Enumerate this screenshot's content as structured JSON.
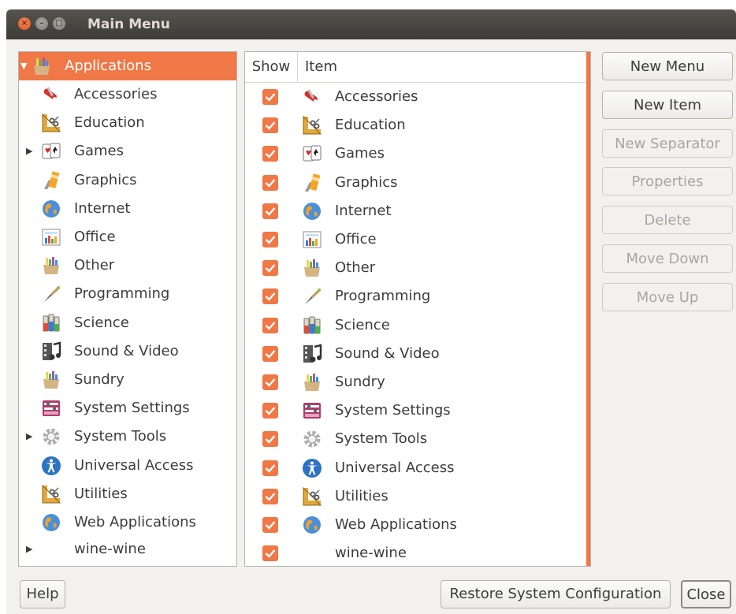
{
  "window": {
    "title": "Main Menu"
  },
  "tree": {
    "selected": {
      "label": "Applications",
      "icon": "applications-other-icon"
    },
    "items": [
      {
        "label": "Accessories",
        "icon": "accessories-icon",
        "expander": false
      },
      {
        "label": "Education",
        "icon": "education-icon",
        "expander": false
      },
      {
        "label": "Games",
        "icon": "games-icon",
        "expander": true
      },
      {
        "label": "Graphics",
        "icon": "graphics-icon",
        "expander": false
      },
      {
        "label": "Internet",
        "icon": "internet-icon",
        "expander": false
      },
      {
        "label": "Office",
        "icon": "office-icon",
        "expander": false
      },
      {
        "label": "Other",
        "icon": "other-icon",
        "expander": false
      },
      {
        "label": "Programming",
        "icon": "programming-icon",
        "expander": false
      },
      {
        "label": "Science",
        "icon": "science-icon",
        "expander": false
      },
      {
        "label": "Sound & Video",
        "icon": "sound-video-icon",
        "expander": false
      },
      {
        "label": "Sundry",
        "icon": "sundry-icon",
        "expander": false
      },
      {
        "label": "System Settings",
        "icon": "system-settings-icon",
        "expander": false
      },
      {
        "label": "System Tools",
        "icon": "system-tools-icon",
        "expander": true
      },
      {
        "label": "Universal Access",
        "icon": "universal-access-icon",
        "expander": false
      },
      {
        "label": "Utilities",
        "icon": "utilities-icon",
        "expander": false
      },
      {
        "label": "Web Applications",
        "icon": "web-applications-icon",
        "expander": false
      },
      {
        "label": "wine-wine",
        "icon": "",
        "expander": true
      }
    ]
  },
  "list": {
    "header_show": "Show",
    "header_item": "Item",
    "rows": [
      {
        "label": "Accessories",
        "shown": true
      },
      {
        "label": "Education",
        "shown": true
      },
      {
        "label": "Games",
        "shown": true
      },
      {
        "label": "Graphics",
        "shown": true
      },
      {
        "label": "Internet",
        "shown": true
      },
      {
        "label": "Office",
        "shown": true
      },
      {
        "label": "Other",
        "shown": true
      },
      {
        "label": "Programming",
        "shown": true
      },
      {
        "label": "Science",
        "shown": true
      },
      {
        "label": "Sound & Video",
        "shown": true
      },
      {
        "label": "Sundry",
        "shown": true
      },
      {
        "label": "System Settings",
        "shown": true
      },
      {
        "label": "System Tools",
        "shown": true
      },
      {
        "label": "Universal Access",
        "shown": true
      },
      {
        "label": "Utilities",
        "shown": true
      },
      {
        "label": "Web Applications",
        "shown": true
      },
      {
        "label": "wine-wine",
        "shown": true
      }
    ]
  },
  "buttons": {
    "new_menu": "New Menu",
    "new_item": "New Item",
    "new_separator": "New Separator",
    "properties": "Properties",
    "delete": "Delete",
    "move_down": "Move Down",
    "move_up": "Move Up"
  },
  "bottom": {
    "help": "Help",
    "restore": "Restore System Configuration",
    "close": "Close"
  },
  "colors": {
    "accent": "#f07746",
    "titlebar": "#3c3b37"
  }
}
